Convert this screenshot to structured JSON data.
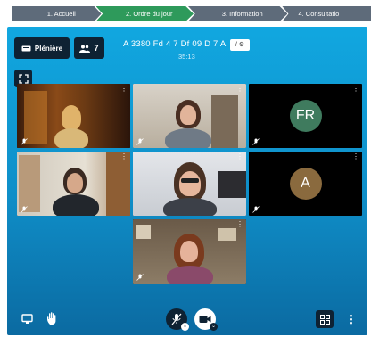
{
  "steps": [
    {
      "label": "1. Accueil",
      "active": false
    },
    {
      "label": "2. Ordre du jour",
      "active": true
    },
    {
      "label": "3. Information",
      "active": false
    },
    {
      "label": "4. Consultatio",
      "active": false
    }
  ],
  "toolbar": {
    "pleniere_label": "Plénière",
    "participants_count": "7",
    "meeting_title": "A 3380 Fd 4 7 Df 09 D 7 A",
    "elapsed": "35:13",
    "edit_label": "/ ⚙"
  },
  "tiles": [
    {
      "name": "tile-1",
      "type": "video"
    },
    {
      "name": "tile-2",
      "type": "video"
    },
    {
      "name": "tile-fr",
      "type": "avatar",
      "initials": "FR",
      "color": "#3f7b5e"
    },
    {
      "name": "tile-4",
      "type": "video"
    },
    {
      "name": "tile-5",
      "type": "video"
    },
    {
      "name": "tile-a",
      "type": "avatar",
      "initials": "A",
      "color": "#8a6a3e"
    },
    {
      "name": "tile-7",
      "type": "video"
    }
  ],
  "controls": {
    "icons": [
      "screen-share-icon",
      "raise-hand-icon",
      "mic-muted-icon",
      "camera-icon",
      "grid-view-icon",
      "more-icon"
    ]
  },
  "colors": {
    "active_step": "#2e9a5b",
    "inactive_step": "#5e6b7a",
    "meeting_bg": "#11a7e0",
    "dark_button": "#0e2233"
  }
}
